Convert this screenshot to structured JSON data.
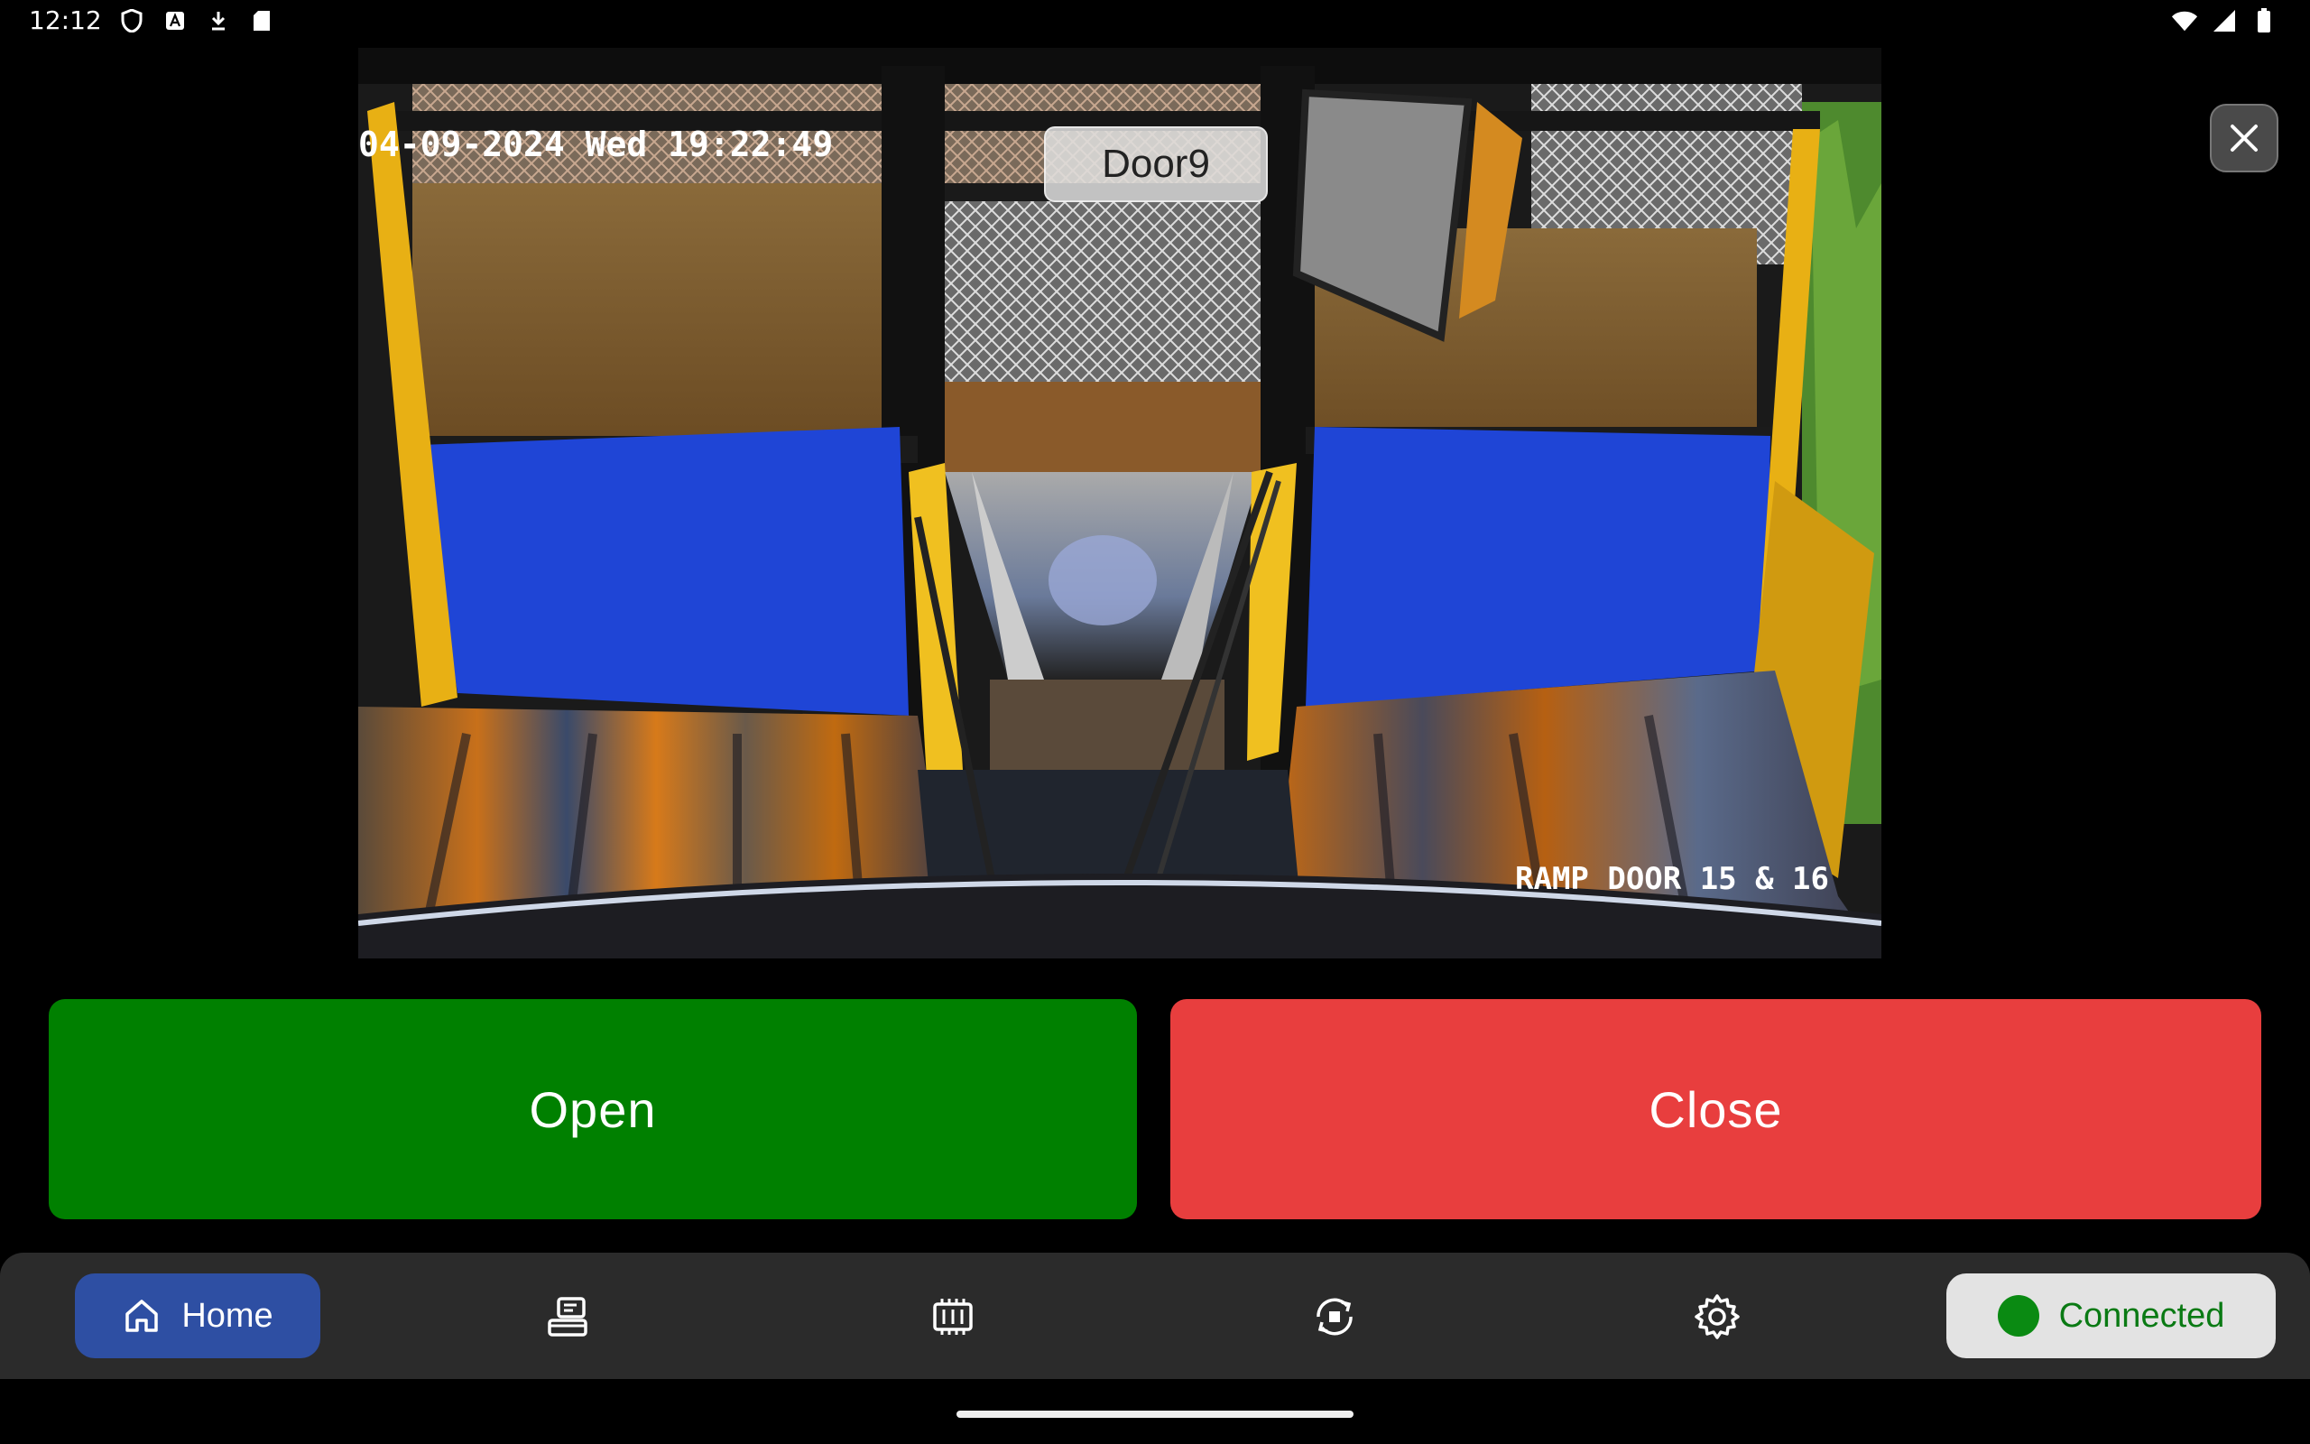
{
  "status_bar": {
    "time": "12:12",
    "left_icons": [
      "shield-icon",
      "keyboard-a-icon",
      "download-icon",
      "sd-card-icon"
    ],
    "right_icons": [
      "wifi-icon",
      "signal-icon",
      "battery-icon"
    ]
  },
  "camera": {
    "timestamp_overlay": "04-09-2024 Wed 19:22:49",
    "door_label": "Door9",
    "location_overlay": "RAMP DOOR 15 & 16"
  },
  "actions": {
    "open_label": "Open",
    "close_label": "Close",
    "open_color": "#008000",
    "close_color": "#e83e3e"
  },
  "nav": {
    "home_label": "Home",
    "items": [
      "home-icon",
      "device-list-icon",
      "memory-icon",
      "sync-icon",
      "settings-icon"
    ],
    "connection_status": "Connected",
    "connection_color": "#0a8a12",
    "active_color": "#2e4fa3"
  }
}
